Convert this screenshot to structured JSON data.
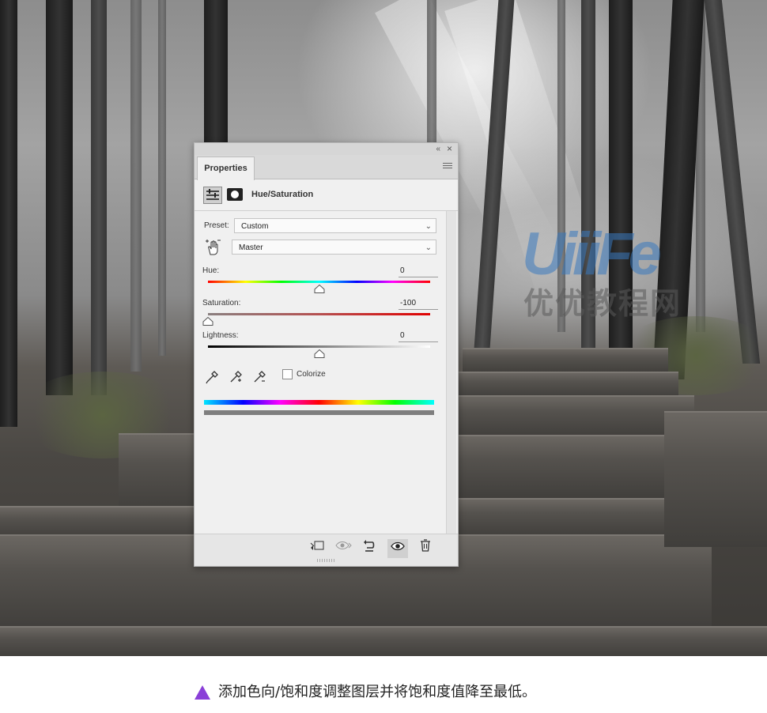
{
  "panel": {
    "tab_label": "Properties",
    "title": "Hue/Saturation",
    "preset_label": "Preset:",
    "preset_value": "Custom",
    "channel_value": "Master",
    "hue_label": "Hue:",
    "hue_value": "0",
    "hue_level": 0.5,
    "saturation_label": "Saturation:",
    "saturation_value": "-100",
    "saturation_level": 0.0,
    "lightness_label": "Lightness:",
    "lightness_value": "0",
    "lightness_level": 0.5,
    "colorize_label": "Colorize",
    "colorize_checked": false
  },
  "icons": {
    "collapse": "double-chevron-left-icon",
    "close": "close-icon",
    "menu": "hamburger-menu-icon",
    "adjustment": "hue-saturation-layer-icon",
    "mask": "layer-mask-icon",
    "hand": "targeted-adjustment-hand-icon",
    "droppers": [
      "eyedropper-icon",
      "eyedropper-plus-icon",
      "eyedropper-minus-icon"
    ],
    "footer": [
      "clip-to-layer-icon",
      "view-previous-state-icon",
      "reset-icon",
      "visibility-eye-icon",
      "trash-icon"
    ]
  },
  "watermark": {
    "latin": "UiiiFe",
    "chinese": "优优教程网"
  },
  "caption": {
    "text": "添加色向/饱和度调整图层并将饱和度值降至最低。",
    "bullet_color": "#8a3fd8"
  }
}
